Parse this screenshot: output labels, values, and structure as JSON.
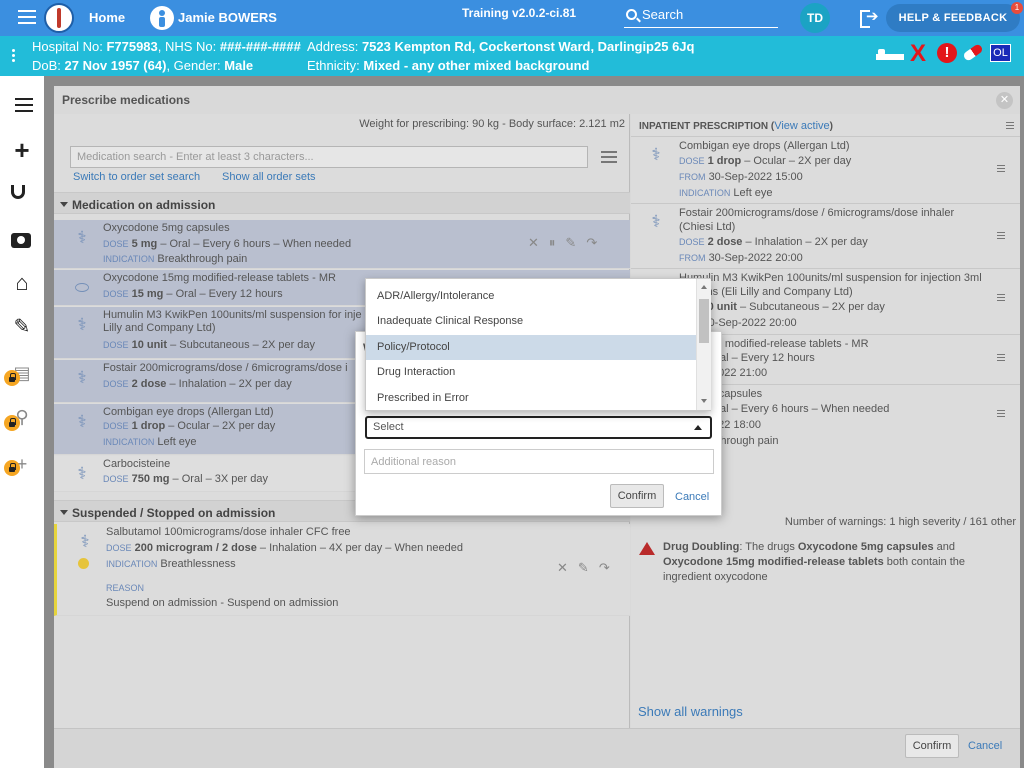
{
  "topbar": {
    "home_label": "Home",
    "patient_name": "Jamie BOWERS",
    "version": "Training v2.0.2-ci.81",
    "search_label": "Search",
    "user_initials": "TD",
    "help_label": "HELP & FEEDBACK",
    "help_badge": "1",
    "colors": {
      "bar": "#3b8fe0",
      "avatar": "#1ba3c4"
    }
  },
  "banner": {
    "hospital_label": "Hospital No:",
    "hospital_no": "F775983",
    "nhs_label": ", NHS No:",
    "nhs_no": "###-###-####",
    "dob_label": "DoB:",
    "dob": "27 Nov 1957 (64)",
    "gender_label": ", Gender:",
    "gender": "Male",
    "address_label": "Address:",
    "address": "7523 Kempton Rd, Cockertonst Ward, Darlingip25 6Jq",
    "ethnicity_label": "Ethnicity:",
    "ethnicity": "Mixed - any other mixed background",
    "icon_x": "X",
    "icon_alert": "!",
    "badge_ol": "OL",
    "colors": {
      "bar": "#22bcd9",
      "alert": "#e3161b",
      "badge": "#1a2bb8"
    }
  },
  "nav": {
    "icons": [
      "list-icon",
      "plus-icon",
      "stethoscope-icon",
      "camera-icon",
      "house-icon",
      "edit-document-icon",
      "clipboard-icon",
      "person-walk-icon",
      "plus-locked-icon"
    ]
  },
  "panel": {
    "title": "Prescribe medications",
    "weight_info": "Weight for prescribing: 90 kg - Body surface: 2.121 m2",
    "search_placeholder": "Medication search - Enter at least 3 characters...",
    "link_order": "Switch to order set search",
    "link_all": "Show all order sets",
    "section_admission": "Medication on admission",
    "section_suspended": "Suspended / Stopped on admission",
    "labels": {
      "dose": "DOSE",
      "indication": "INDICATION",
      "reason": "REASON",
      "from": "FROM"
    },
    "admission_meds": [
      {
        "name": "Oxycodone 5mg capsules",
        "dose": "5 mg",
        "route": " – Oral – Every 6 hours – When needed",
        "indication": "Breakthrough pain"
      },
      {
        "name": "Oxycodone 15mg modified-release tablets - MR",
        "dose": "15 mg",
        "route": " – Oral – Every 12 hours"
      },
      {
        "name": "Humulin M3 KwikPen 100units/ml suspension for inje",
        "name2": "Lilly and Company Ltd)",
        "dose": "10 unit",
        "route": " – Subcutaneous – 2X per day"
      },
      {
        "name": "Fostair 200micrograms/dose / 6micrograms/dose i",
        "dose": "2 dose",
        "route": " – Inhalation – 2X per day"
      },
      {
        "name": "Combigan eye drops (Allergan Ltd)",
        "dose": "1 drop",
        "route": " – Ocular – 2X per day",
        "indication": "Left eye"
      },
      {
        "name": "Carbocisteine",
        "dose": "750 mg",
        "route": " – Oral – 3X per day"
      }
    ],
    "suspended_med": {
      "name": "Salbutamol 100micrograms/dose inhaler CFC free",
      "dose": "200 microgram / 2 dose",
      "route": " – Inhalation – 4X per day – When needed",
      "indication": "Breathlessness",
      "reason": "Suspend on admission - Suspend on admission"
    },
    "inpatient": {
      "heading": "INPATIENT PRESCRIPTION",
      "heading_open": " (",
      "view_active": "View active",
      "heading_close": ")",
      "rows": [
        {
          "name": "Combigan eye drops (Allergan Ltd)",
          "dose": "1 drop",
          "route": " – Ocular – 2X per day",
          "from": "30-Sep-2022 15:00",
          "indication": "Left eye"
        },
        {
          "name": "Fostair 200micrograms/dose / 6micrograms/dose inhaler",
          "name2": "(Chiesi Ltd)",
          "dose": "2 dose",
          "route": " – Inhalation – 2X per day",
          "from": "30-Sep-2022 20:00"
        },
        {
          "name": "Humulin M3 KwikPen 100units/ml suspension for injection 3ml",
          "name2": "ed pens (Eli Lilly and Company Ltd)",
          "dose": "0 unit",
          "route": " – Subcutaneous – 2X per day",
          "from": "0-Sep-2022 20:00"
        },
        {
          "name": "ne 15mg modified-release tablets - MR",
          "dose": "mg",
          "route": " – Oral – Every 12 hours",
          "from": "0-Sep-2022 21:00"
        },
        {
          "name": "ne 5mg capsules",
          "dose": "mg",
          "route": " – Oral – Every 6 hours – When needed",
          "from": "-Sep-2022 18:00",
          "indication": "Breakthrough pain",
          "indication_prefix": "N"
        }
      ],
      "warning_count": "Number of warnings: 1 high severity / 161 other",
      "warning": {
        "title": "Drug Doubling",
        "t1": ": The drugs ",
        "drug1": "Oxycodone 5mg capsules",
        "t2": " and ",
        "drug2": "Oxycodone 15mg modified-release tablets",
        "t3": " both contain the ingredient oxycodone"
      },
      "show_all": "Show all warnings"
    },
    "footer": {
      "confirm": "Confirm",
      "cancel": "Cancel"
    }
  },
  "dialog": {
    "heading": "W",
    "select_value": "Select",
    "additional_placeholder": "Additional reason",
    "confirm": "Confirm",
    "cancel": "Cancel",
    "options": [
      "ADR/Allergy/Intolerance",
      "Inadequate Clinical Response",
      "Policy/Protocol",
      "Drug Interaction",
      "Prescribed in Error"
    ],
    "highlighted_option": "Policy/Protocol"
  }
}
